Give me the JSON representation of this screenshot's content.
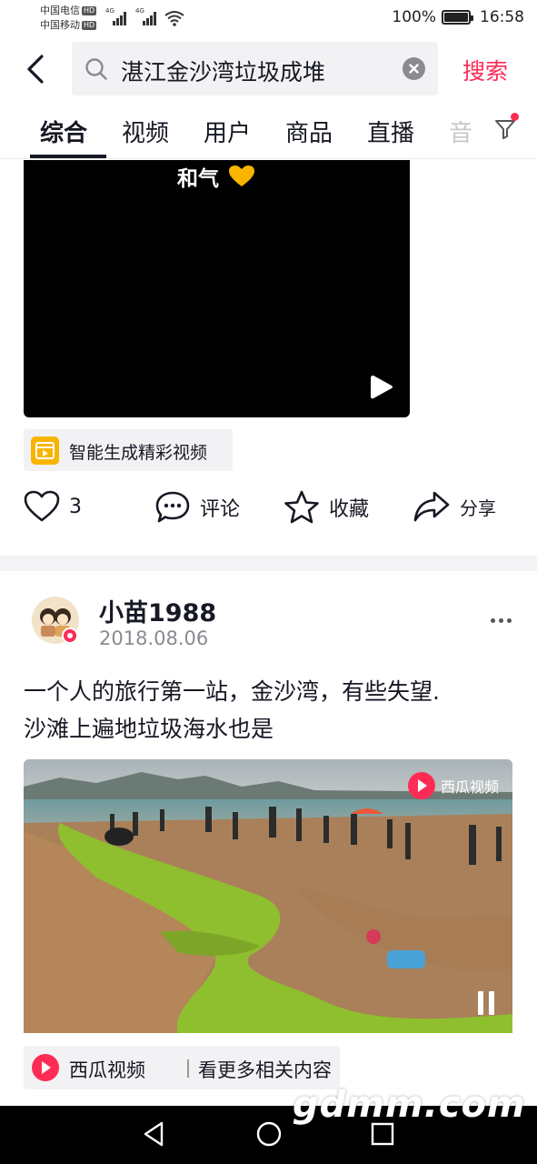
{
  "status_bar": {
    "carrier1": "中国电信",
    "carrier2": "中国移动",
    "hd_label": "HD",
    "network1": "4G",
    "network2": "4G",
    "battery": "100%",
    "time": "16:58"
  },
  "search": {
    "query": "湛江金沙湾垃圾成堆",
    "button_label": "搜索"
  },
  "tabs": [
    {
      "label": "综合",
      "active": true
    },
    {
      "label": "视频",
      "active": false
    },
    {
      "label": "用户",
      "active": false
    },
    {
      "label": "商品",
      "active": false
    },
    {
      "label": "直播",
      "active": false
    },
    {
      "label": "音",
      "active": false
    }
  ],
  "video1": {
    "caption": "和气"
  },
  "smart_chip": {
    "label": "智能生成精彩视频"
  },
  "actions": {
    "like_count": "3",
    "comment_label": "评论",
    "favorite_label": "收藏",
    "share_label": "分享"
  },
  "post": {
    "username": "小苗1988",
    "date": "2018.08.06",
    "text_line1": "一个人的旅行第一站，金沙湾，有些失望.",
    "text_line2": "沙滩上遍地垃圾海水也是",
    "video_watermark": "西瓜视频"
  },
  "source_chip": {
    "name": "西瓜视频",
    "more_label": "看更多相关内容"
  },
  "site_watermark": "gdmm.com",
  "colors": {
    "accent": "#fe2c55",
    "text": "#161823",
    "secondary_text": "#8a8b91",
    "chip_bg": "#f2f2f4"
  }
}
